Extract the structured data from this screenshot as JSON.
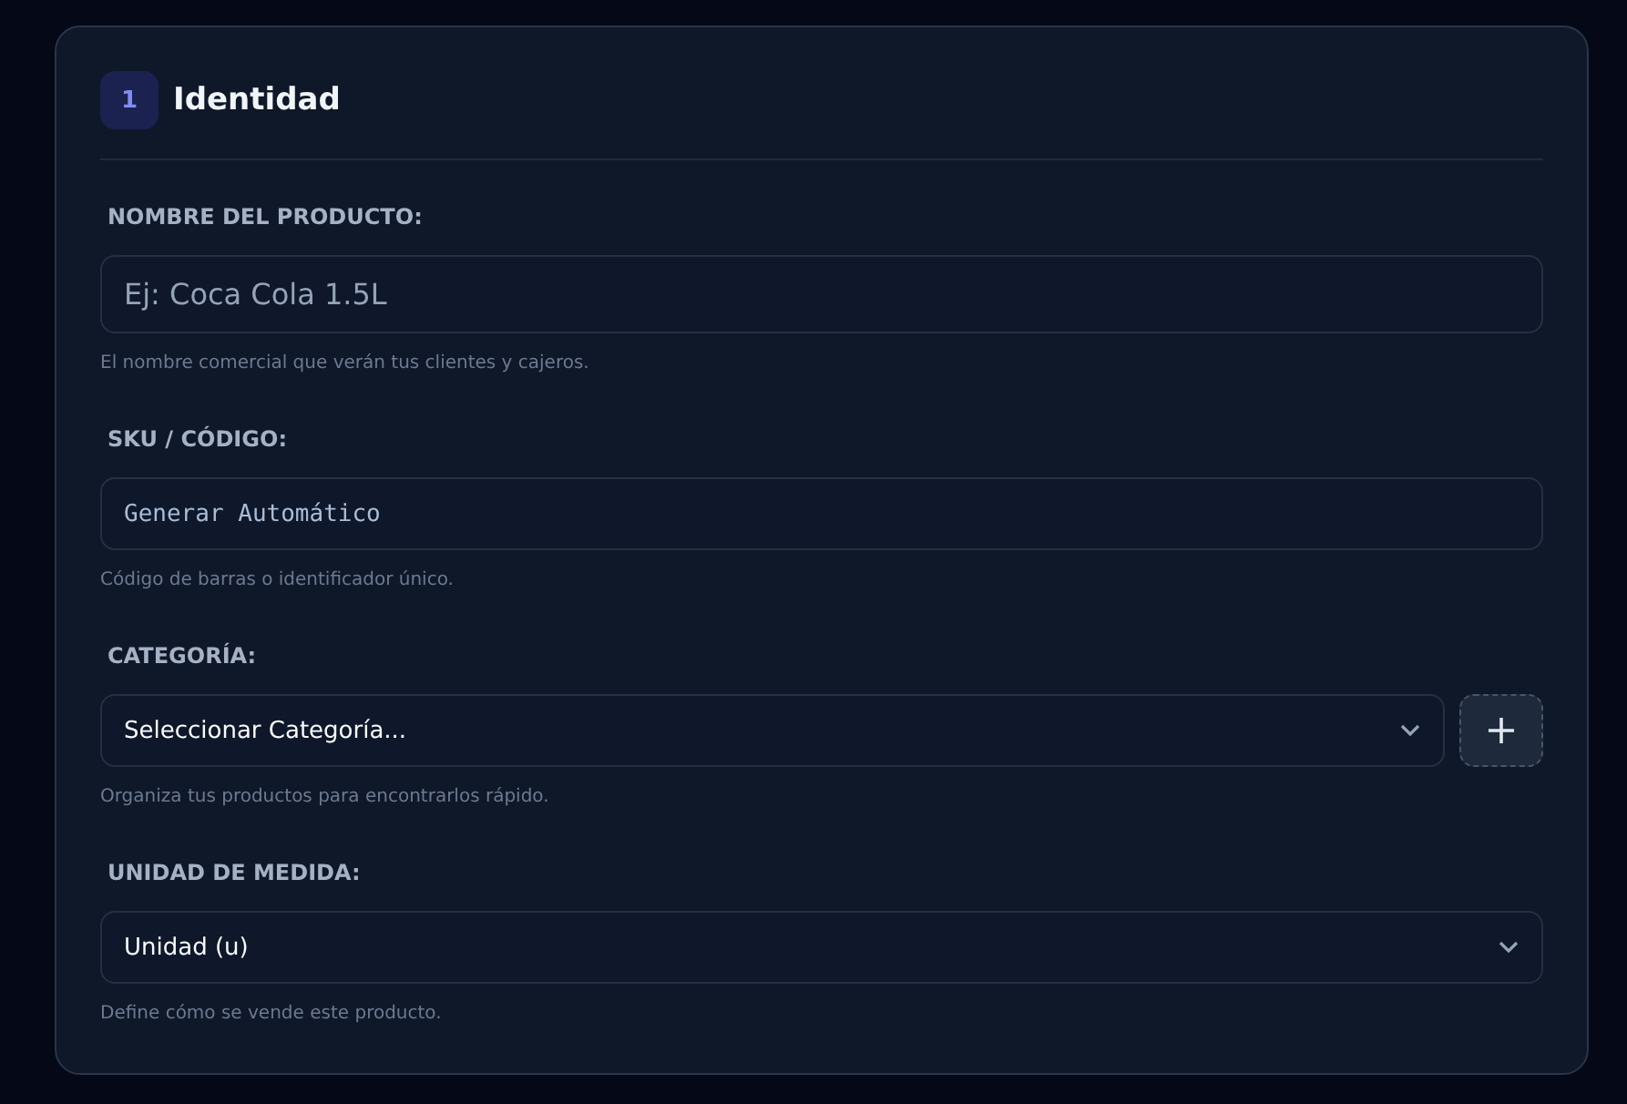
{
  "section": {
    "number": "1",
    "title": "Identidad"
  },
  "fields": [
    {
      "kind": "text",
      "label": "NOMBRE DEL PRODUCTO:",
      "placeholder": "Ej: Coca Cola 1.5L",
      "hint": "El nombre comercial que verán tus clientes y cajeros."
    },
    {
      "kind": "code",
      "label": "SKU / CÓDIGO:",
      "placeholder": "Generar Automático",
      "hint": "Código de barras o identificador único."
    },
    {
      "kind": "select",
      "label": "CATEGORÍA:",
      "value": "Seleccionar Categoría...",
      "add_button": true,
      "hint": "Organiza tus productos para encontrarlos rápido."
    },
    {
      "kind": "select",
      "label": "UNIDAD DE MEDIDA:",
      "value": "Unidad (u)",
      "add_button": false,
      "hint": "Define cómo se vende este producto."
    }
  ]
}
